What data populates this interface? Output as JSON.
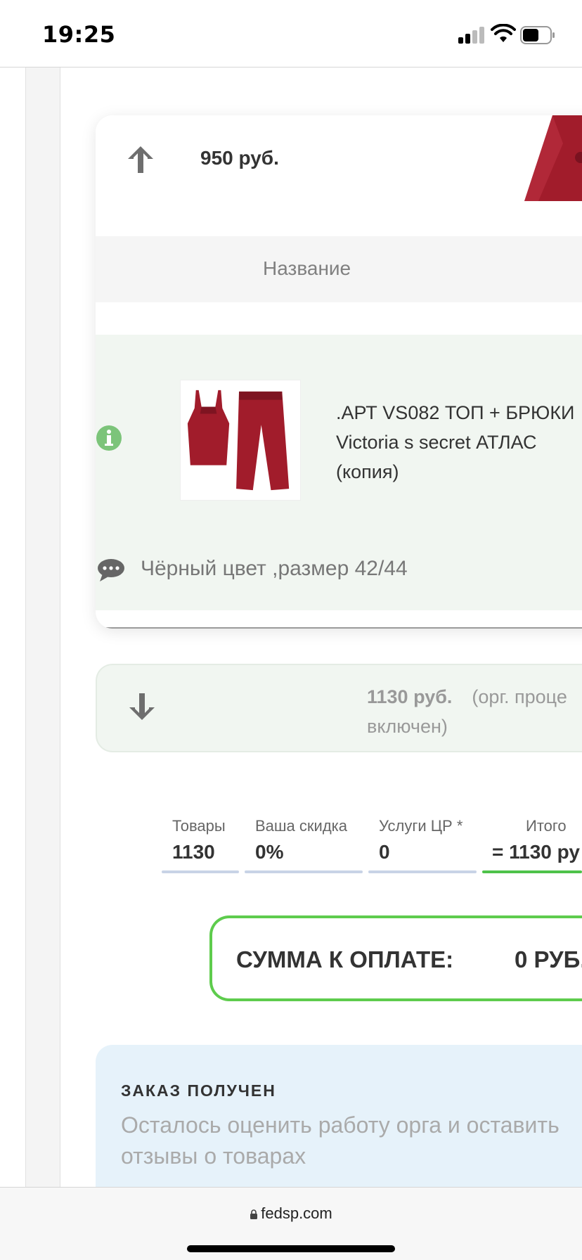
{
  "status_bar": {
    "time": "19:25"
  },
  "top_row": {
    "price": "950 руб."
  },
  "table": {
    "name_header": "Название"
  },
  "product": {
    "title_lines": [
      ".АРТ VS082 ТОП + БРЮКИ",
      "Victoria s secret АТЛАС",
      "(копия)"
    ],
    "comment": "Чёрный цвет ,размер 42/44"
  },
  "price_row": {
    "amount": "1130 руб.",
    "org_note_line1": "(орг. проце",
    "org_note_line2": "включен)"
  },
  "totals": {
    "goods_label": "Товары",
    "goods_value": "1130",
    "discount_label": "Ваша скидка",
    "discount_value": "0%",
    "services_label": "Услуги ЦР *",
    "services_value": "0",
    "total_label": "Итого",
    "total_value": "= 1130 ру"
  },
  "payment": {
    "label": "СУММА К ОПЛАТЕ:",
    "value": "0 РУБ."
  },
  "order_status": {
    "title": "ЗАКАЗ ПОЛУЧЕН",
    "text_line1": "Осталось оценить работу орга и оставить",
    "text_line2": "отзывы о товарах"
  },
  "browser": {
    "url": "fedsp.com"
  },
  "colors": {
    "accent_green": "#5ecc4d",
    "item_bg": "#f1f6f1",
    "order_bg": "#e6f2fa"
  },
  "icons": [
    "arrow-up-icon",
    "arrow-down-icon",
    "info-icon",
    "comment-icon",
    "lock-icon",
    "signal-icon",
    "wifi-icon",
    "battery-icon"
  ]
}
